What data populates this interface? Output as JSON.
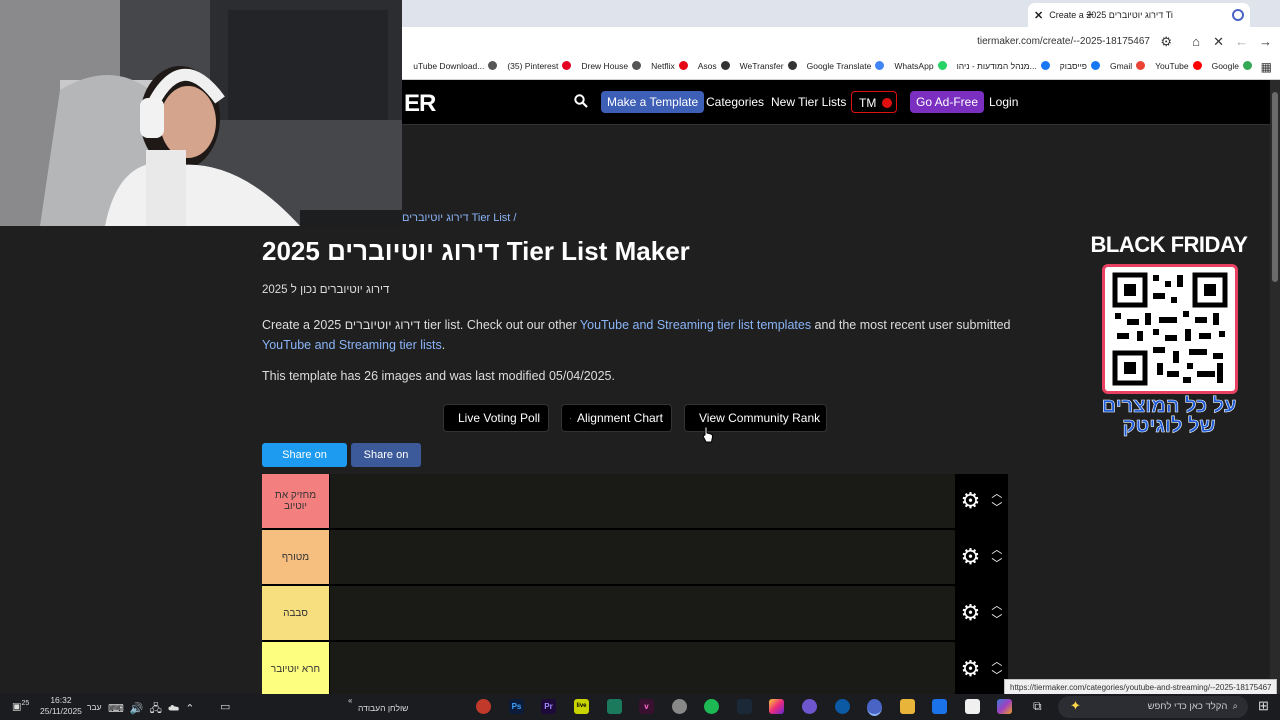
{
  "browser": {
    "tab_title": "Create a 2025 דירוג יוטיוברים Ti",
    "url": "tiermaker.com/create/--2025-18175467",
    "bookmarks": [
      "Google",
      "YouTube",
      "Gmail",
      "פייסבוק",
      "מנהל המודעות - ניהו...",
      "WhatsApp",
      "Google Translate",
      "WeTransfer",
      "Asos",
      "Netflix",
      "Drew House",
      "(35) Pinterest",
      "uTube Download..."
    ],
    "status_url": "https://tiermaker.com/categories/youtube-and-streaming/--2025-18175467"
  },
  "header": {
    "logo": "ER",
    "make_template": "Make a Template",
    "categories": "Categories",
    "new_tier_lists": "New Tier Lists",
    "tm": "TM",
    "go_ad_free": "Go Ad-Free",
    "login": "Login"
  },
  "page": {
    "breadcrumb": "דירוג יוטיוברים Tier List /",
    "title": "2025 דירוג יוטיוברים Tier List Maker",
    "subtitle": "דירוג יוטיוברים נכון ל 2025",
    "desc_1": "Create a 2025 דירוג יוטיוברים tier list. Check out our other ",
    "desc_link1": "YouTube and Streaming tier list templates",
    "desc_2": " and the most recent user submitted ",
    "desc_link2": "YouTube and Streaming tier lists",
    "desc_3": ".",
    "info": "This template has 26 images and was last modified 05/04/2025.",
    "live_voting": "Live Voting Poll",
    "alignment_chart": "Alignment Chart",
    "community_rank": "View Community Rank",
    "share_twitter": "Share on Twitter",
    "share_fb": "Share on FB"
  },
  "tiers": [
    {
      "label": "מחזיק את יוטיוב",
      "color": "#f47f7f"
    },
    {
      "label": "מטורף",
      "color": "#f6bf80"
    },
    {
      "label": "סבבה",
      "color": "#f7df80"
    },
    {
      "label": "חרא יוטיובר",
      "color": "#fdfd7f"
    }
  ],
  "ad": {
    "title": "BLACK FRIDAY",
    "subtitle": "על כל המוצרים של לוגיטק"
  },
  "taskbar": {
    "time": "16:32",
    "date": "25/11/2025",
    "lang": "עבר",
    "search_placeholder": "הקלד כאן כדי לחפש",
    "desktop": "שולחן העבודה",
    "notif": "25"
  }
}
